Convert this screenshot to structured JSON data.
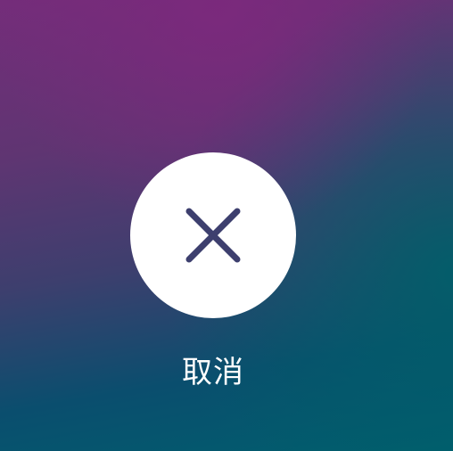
{
  "cancel": {
    "icon": "close-icon",
    "label": "取消",
    "button_bg": "#ffffff",
    "icon_color": "#3d3f6e"
  }
}
